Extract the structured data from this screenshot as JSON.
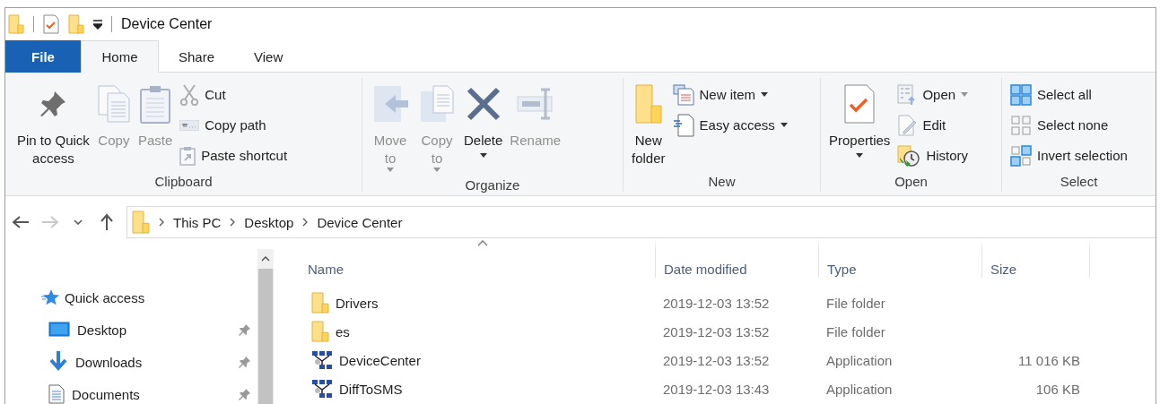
{
  "window": {
    "title": "Device Center"
  },
  "tabs": [
    {
      "label": "File",
      "kind": "menu",
      "selected": false
    },
    {
      "label": "Home",
      "kind": "tab",
      "selected": true
    },
    {
      "label": "Share",
      "kind": "tab",
      "selected": false
    },
    {
      "label": "View",
      "kind": "tab",
      "selected": false
    }
  ],
  "ribbon": {
    "groups": [
      {
        "label": "Clipboard",
        "items": [
          {
            "kind": "large",
            "label": "Pin to Quick\naccess",
            "disabled": false,
            "dropdown": false
          },
          {
            "kind": "large",
            "label": "Copy",
            "disabled": true,
            "dropdown": false
          },
          {
            "kind": "large",
            "label": "Paste",
            "disabled": true,
            "dropdown": false
          },
          {
            "kind": "small",
            "label": "Cut",
            "disabled": true,
            "dropdown": false
          },
          {
            "kind": "small",
            "label": "Copy path",
            "disabled": true,
            "dropdown": false
          },
          {
            "kind": "small",
            "label": "Paste shortcut",
            "disabled": true,
            "dropdown": false
          }
        ]
      },
      {
        "label": "Organize",
        "items": [
          {
            "kind": "large",
            "label": "Move\nto",
            "disabled": true,
            "dropdown": true
          },
          {
            "kind": "large",
            "label": "Copy\nto",
            "disabled": true,
            "dropdown": true
          },
          {
            "kind": "large",
            "label": "Delete",
            "disabled": false,
            "dropdown": true
          },
          {
            "kind": "large",
            "label": "Rename",
            "disabled": true,
            "dropdown": false
          }
        ]
      },
      {
        "label": "New",
        "items": [
          {
            "kind": "large",
            "label": "New\nfolder",
            "disabled": false,
            "dropdown": false
          },
          {
            "kind": "small",
            "label": "New item",
            "disabled": false,
            "dropdown": true
          },
          {
            "kind": "small",
            "label": "Easy access",
            "disabled": false,
            "dropdown": true
          }
        ]
      },
      {
        "label": "Open",
        "items": [
          {
            "kind": "large",
            "label": "Properties",
            "disabled": false,
            "dropdown": true
          },
          {
            "kind": "small",
            "label": "Open",
            "disabled": true,
            "dropdown": true
          },
          {
            "kind": "small",
            "label": "Edit",
            "disabled": true,
            "dropdown": false
          },
          {
            "kind": "small",
            "label": "History",
            "disabled": false,
            "dropdown": false
          }
        ]
      },
      {
        "label": "Select",
        "items": [
          {
            "kind": "small",
            "label": "Select all",
            "disabled": false,
            "dropdown": false
          },
          {
            "kind": "small",
            "label": "Select none",
            "disabled": false,
            "dropdown": false
          },
          {
            "kind": "small",
            "label": "Invert selection",
            "disabled": false,
            "dropdown": false
          }
        ]
      }
    ]
  },
  "nav_buttons": [
    {
      "kind": "back",
      "disabled": false
    },
    {
      "kind": "forward",
      "disabled": true
    },
    {
      "kind": "recent",
      "disabled": false
    },
    {
      "kind": "up",
      "disabled": false
    }
  ],
  "address": {
    "parts": [
      "This PC",
      "Desktop",
      "Device Center"
    ]
  },
  "sidebar": {
    "items": [
      {
        "label": "Quick access",
        "kind": "header",
        "pinned": false
      },
      {
        "label": "Desktop",
        "kind": "item",
        "pinned": true
      },
      {
        "label": "Downloads",
        "kind": "item",
        "pinned": true
      },
      {
        "label": "Documents",
        "kind": "item",
        "pinned": true
      }
    ]
  },
  "table": {
    "columns": [
      {
        "label": "Name",
        "sorted": true
      },
      {
        "label": "Date modified",
        "sorted": false
      },
      {
        "label": "Type",
        "sorted": false
      },
      {
        "label": "Size",
        "sorted": false
      }
    ],
    "rows": [
      {
        "kind": "folder",
        "name": "Drivers",
        "date": "2019-12-03 13:52",
        "type": "File folder",
        "size": ""
      },
      {
        "kind": "folder",
        "name": "es",
        "date": "2019-12-03 13:52",
        "type": "File folder",
        "size": ""
      },
      {
        "kind": "application",
        "name": "DeviceCenter",
        "date": "2019-12-03 13:52",
        "type": "Application",
        "size": "11 016 KB"
      },
      {
        "kind": "application",
        "name": "DiffToSMS",
        "date": "2019-12-03 13:43",
        "type": "Application",
        "size": "106 KB"
      }
    ]
  }
}
